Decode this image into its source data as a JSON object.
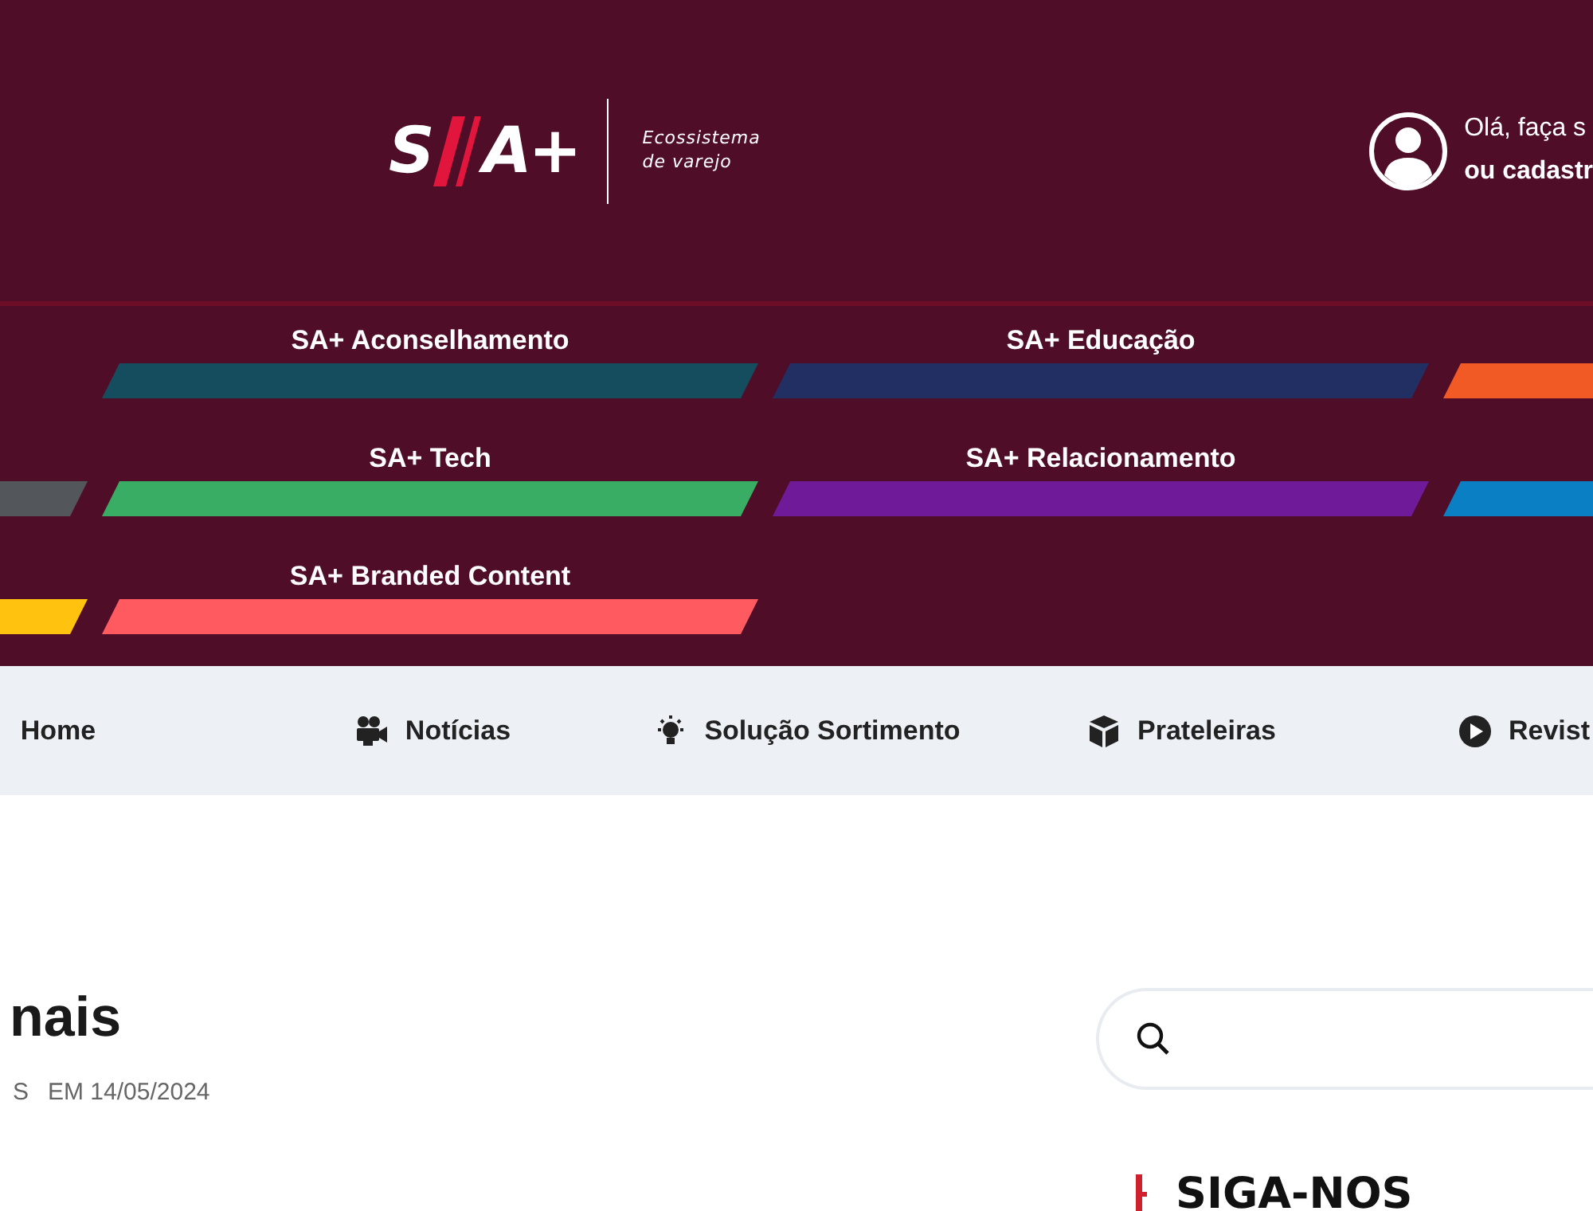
{
  "header": {
    "logo": {
      "left": "S",
      "right": "A+"
    },
    "tagline": "Ecossistema de varejo",
    "account": {
      "greeting": "Olá, faça s",
      "signup": "ou cadastr"
    }
  },
  "categories": [
    {
      "kind": "blank"
    },
    {
      "label": "SA+ Aconselhamento",
      "color": "#154c5e"
    },
    {
      "label": "SA+ Educação",
      "color": "#222f63"
    },
    {
      "color": "#f15a24"
    },
    {
      "color": "#53565a"
    },
    {
      "label": "SA+ Tech",
      "color": "#3aad65"
    },
    {
      "label": "SA+ Relacionamento",
      "color": "#6e1a99"
    },
    {
      "color": "#0a7fc4"
    },
    {
      "color": "#ffc20e"
    },
    {
      "label": "SA+ Branded Content",
      "color": "#ff5a5f"
    }
  ],
  "nav": [
    {
      "label": "Home",
      "kind": "plain"
    },
    {
      "label": "Notícias",
      "kind": "video"
    },
    {
      "label": "Solução Sortimento",
      "kind": "idea"
    },
    {
      "label": "Prateleiras",
      "kind": "product"
    },
    {
      "label": "Revist",
      "kind": "magazine"
    }
  ],
  "article": {
    "title": "nais",
    "author": "S",
    "date": "EM 14/05/2024"
  },
  "sidebar": {
    "follow_title": "SIGA-NOS"
  }
}
